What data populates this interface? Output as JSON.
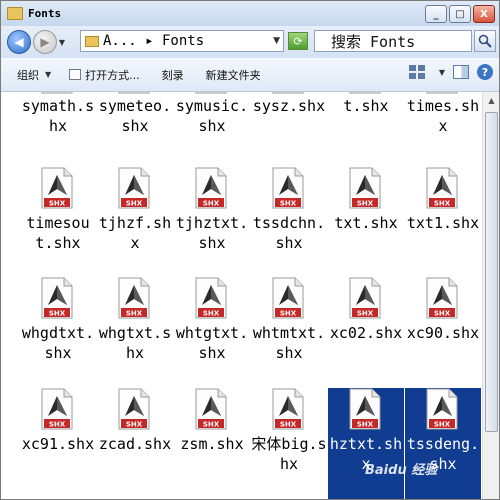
{
  "window": {
    "title": "Fonts",
    "buttons": {
      "minimize": "_",
      "maximize": "□",
      "close": "X"
    }
  },
  "nav": {
    "address": "A... ▸ Fonts",
    "search_placeholder": "搜索 Fonts"
  },
  "toolbar": {
    "organize": "组织",
    "open_with": "打开方式...",
    "burn": "刻录",
    "new_folder": "新建文件夹"
  },
  "files": [
    {
      "name": "symath.shx",
      "selected": false,
      "row": 0,
      "col": 0
    },
    {
      "name": "symeteo.shx",
      "selected": false,
      "row": 0,
      "col": 1
    },
    {
      "name": "symusic.shx",
      "selected": false,
      "row": 0,
      "col": 2
    },
    {
      "name": "sysz.shx",
      "selected": false,
      "row": 0,
      "col": 3
    },
    {
      "name": "t.shx",
      "selected": false,
      "row": 0,
      "col": 4
    },
    {
      "name": "times.shx",
      "selected": false,
      "row": 0,
      "col": 5
    },
    {
      "name": "timesout.shx",
      "selected": false,
      "row": 1,
      "col": 0
    },
    {
      "name": "tjhzf.shx",
      "selected": false,
      "row": 1,
      "col": 1
    },
    {
      "name": "tjhztxt.shx",
      "selected": false,
      "row": 1,
      "col": 2
    },
    {
      "name": "tssdchn.shx",
      "selected": false,
      "row": 1,
      "col": 3
    },
    {
      "name": "txt.shx",
      "selected": false,
      "row": 1,
      "col": 4
    },
    {
      "name": "txt1.shx",
      "selected": false,
      "row": 1,
      "col": 5
    },
    {
      "name": "whgdtxt.shx",
      "selected": false,
      "row": 2,
      "col": 0
    },
    {
      "name": "whgtxt.shx",
      "selected": false,
      "row": 2,
      "col": 1
    },
    {
      "name": "whtgtxt.shx",
      "selected": false,
      "row": 2,
      "col": 2
    },
    {
      "name": "whtmtxt.shx",
      "selected": false,
      "row": 2,
      "col": 3
    },
    {
      "name": "xc02.shx",
      "selected": false,
      "row": 2,
      "col": 4
    },
    {
      "name": "xc90.shx",
      "selected": false,
      "row": 2,
      "col": 5
    },
    {
      "name": "xc91.shx",
      "selected": false,
      "row": 3,
      "col": 0
    },
    {
      "name": "zcad.shx",
      "selected": false,
      "row": 3,
      "col": 1
    },
    {
      "name": "zsm.shx",
      "selected": false,
      "row": 3,
      "col": 2
    },
    {
      "name": "宋体big.shx",
      "selected": false,
      "row": 3,
      "col": 3
    },
    {
      "name": "hztxt.shx",
      "selected": true,
      "row": 3,
      "col": 4
    },
    {
      "name": "tssdeng.shx",
      "selected": true,
      "row": 3,
      "col": 5
    }
  ],
  "icon_badge": "SHX",
  "watermark": "Baidu 经验",
  "colors": {
    "selection": "#103c91",
    "badge": "#c62828"
  }
}
